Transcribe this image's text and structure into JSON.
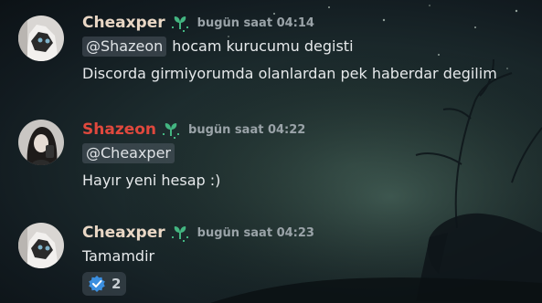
{
  "colors": {
    "username_default": "#e9d7c5",
    "username_shazeon": "#e0483d",
    "badge_green": "#43b581",
    "verified_blue": "#3b8fe0"
  },
  "messages": [
    {
      "author": "Cheaxper",
      "timestamp": "bugün saat 04:14",
      "mention": "@Shazeon",
      "first_text": "hocam kurucumu degisti",
      "second_text": "Discorda girmiyorumda olanlardan pek haberdar degilim"
    },
    {
      "author": "Shazeon",
      "timestamp": "bugün saat 04:22",
      "mention": "@Cheaxper",
      "second_text": "Hayır yeni hesap :)"
    },
    {
      "author": "Cheaxper",
      "timestamp": "bugün saat 04:23",
      "text": "Tamamdir",
      "reaction": {
        "icon": "verified-check-icon",
        "count": "2"
      }
    }
  ]
}
